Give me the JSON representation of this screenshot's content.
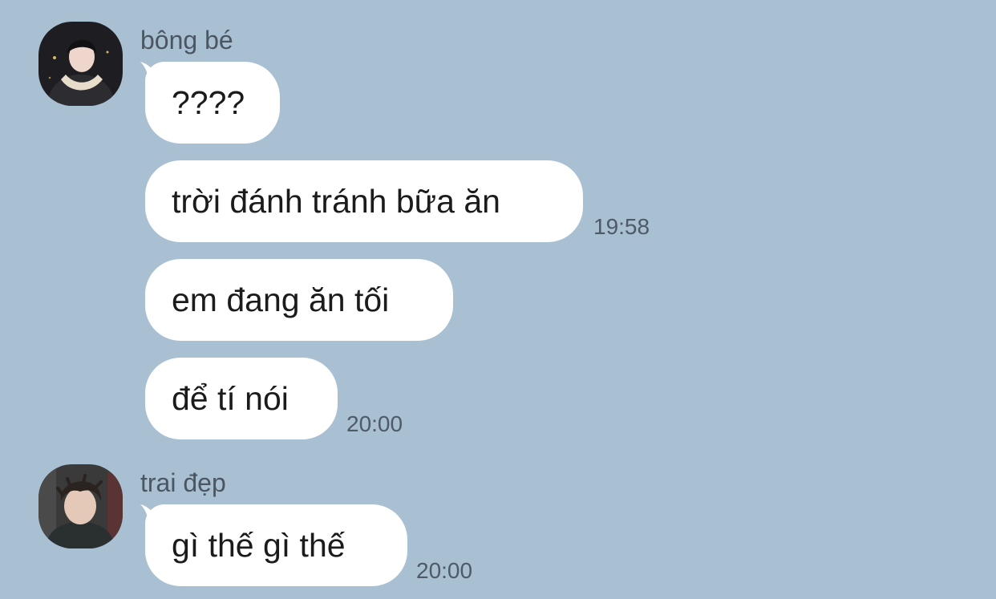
{
  "chat": {
    "groups": [
      {
        "sender": "bông bé",
        "avatar_icon": "user-avatar-dark-jacket-scarf",
        "messages": [
          {
            "text": "????",
            "time": ""
          },
          {
            "text": "trời đánh tránh bữa ăn",
            "time": "19:58"
          },
          {
            "text": "em đang ăn tối",
            "time": ""
          },
          {
            "text": "để tí nói",
            "time": "20:00"
          }
        ]
      },
      {
        "sender": "trai đẹp",
        "avatar_icon": "user-avatar-messy-hair",
        "messages": [
          {
            "text": "gì thế gì thế",
            "time": "20:00"
          }
        ]
      }
    ]
  },
  "colors": {
    "background": "#a9bfd2",
    "bubble": "#ffffff",
    "text": "#1b1b1b",
    "meta_text": "#4d5a68"
  }
}
